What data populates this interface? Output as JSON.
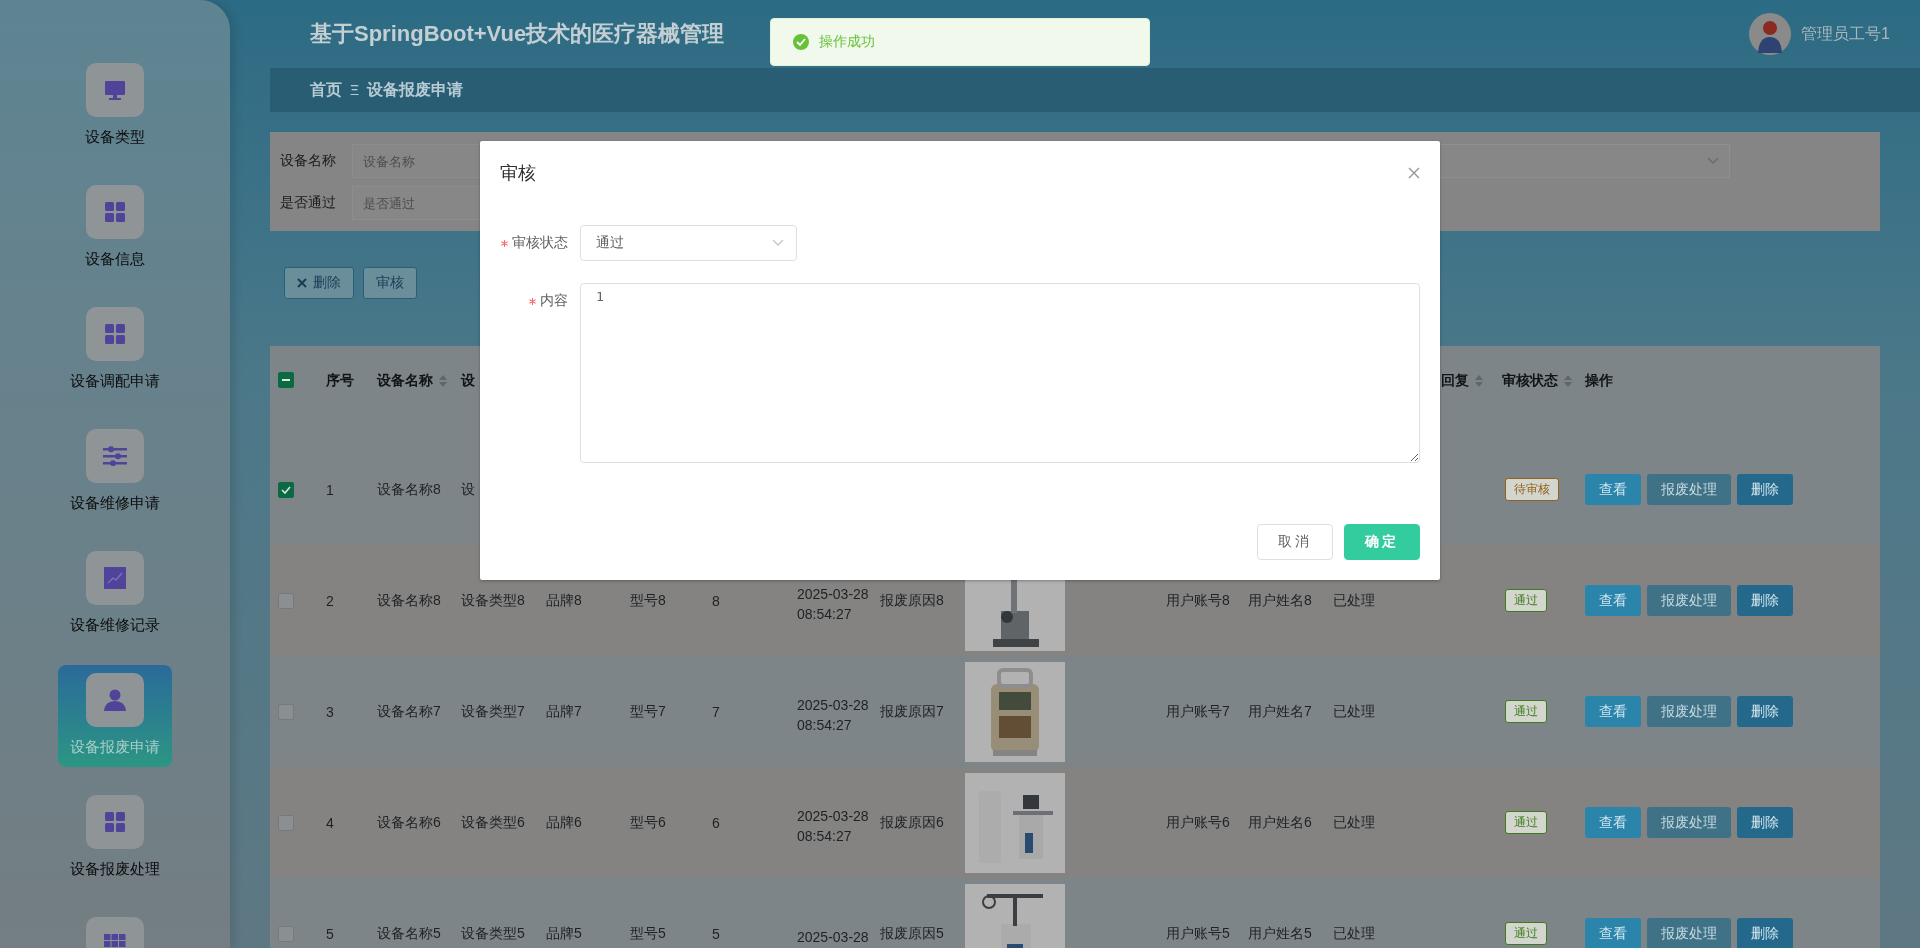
{
  "header": {
    "title": "基于SpringBoot+Vue技术的医疗器械管理",
    "user": "管理员工号1"
  },
  "toast": {
    "message": "操作成功"
  },
  "sidebar": {
    "items": [
      {
        "label": "设备类型",
        "selected": false
      },
      {
        "label": "设备信息",
        "selected": false
      },
      {
        "label": "设备调配申请",
        "selected": false
      },
      {
        "label": "设备维修申请",
        "selected": false
      },
      {
        "label": "设备维修记录",
        "selected": false
      },
      {
        "label": "设备报废申请",
        "selected": true
      },
      {
        "label": "设备报废处理",
        "selected": false
      },
      {
        "selected": false
      }
    ]
  },
  "breadcrumb": {
    "items": [
      "首页",
      "设备报废申请"
    ],
    "separator": "Ξ"
  },
  "search": {
    "fields": [
      {
        "label": "设备名称",
        "placeholder": "设备名称"
      },
      {
        "label": "是否通过",
        "placeholder": "是否通过"
      }
    ]
  },
  "toolbar": [
    {
      "label": "删除",
      "kind": "delete"
    },
    {
      "label": "审核",
      "kind": "review"
    }
  ],
  "table": {
    "select_all": {
      "indeterminate": true
    },
    "columns": [
      {
        "label": "序号",
        "sortable": false
      },
      {
        "label": "设备名称",
        "sortable": true
      },
      {
        "label": "设",
        "sortable": false
      },
      {},
      {},
      {},
      {},
      {},
      {},
      {},
      {},
      {},
      {
        "label": "回复",
        "sortable": true
      },
      {
        "label": "审核状态",
        "sortable": true
      },
      {
        "label": "操作",
        "sortable": false
      }
    ],
    "rows": [
      {
        "selected": true,
        "index": "1",
        "name": "设备名称8",
        "type": "设",
        "status": {
          "label": "待审核",
          "color": "#94601c"
        },
        "actions": [
          {
            "label": "查看",
            "kind": "view",
            "disabled": false
          },
          {
            "label": "报废处理",
            "kind": "process",
            "disabled": true
          },
          {
            "label": "删除",
            "kind": "delete",
            "disabled": false
          }
        ]
      },
      {
        "selected": false,
        "index": "2",
        "name": "设备名称8",
        "type": "设备类型8",
        "brand": "品牌8",
        "model": "型号8",
        "quantity": "8",
        "date": "2025-03-28 08:54:27",
        "reason": "报废原因8",
        "account": "用户账号8",
        "user": "用户姓名8",
        "processed": "已处理",
        "status": {
          "label": "通过",
          "color": "#3f7a1f"
        },
        "actions": [
          {
            "label": "查看",
            "kind": "view",
            "disabled": false
          },
          {
            "label": "报废处理",
            "kind": "process",
            "disabled": true
          },
          {
            "label": "删除",
            "kind": "delete",
            "disabled": false
          }
        ]
      },
      {
        "selected": false,
        "index": "3",
        "name": "设备名称7",
        "type": "设备类型7",
        "brand": "品牌7",
        "model": "型号7",
        "quantity": "7",
        "date": "2025-03-28 08:54:27",
        "reason": "报废原因7",
        "account": "用户账号7",
        "user": "用户姓名7",
        "processed": "已处理",
        "status": {
          "label": "通过",
          "color": "#3f7a1f"
        },
        "actions": [
          {
            "label": "查看",
            "kind": "view",
            "disabled": false
          },
          {
            "label": "报废处理",
            "kind": "process",
            "disabled": true
          },
          {
            "label": "删除",
            "kind": "delete",
            "disabled": false
          }
        ]
      },
      {
        "selected": false,
        "index": "4",
        "name": "设备名称6",
        "type": "设备类型6",
        "brand": "品牌6",
        "model": "型号6",
        "quantity": "6",
        "date": "2025-03-28 08:54:27",
        "reason": "报废原因6",
        "account": "用户账号6",
        "user": "用户姓名6",
        "processed": "已处理",
        "status": {
          "label": "通过",
          "color": "#3f7a1f"
        },
        "actions": [
          {
            "label": "查看",
            "kind": "view",
            "disabled": false
          },
          {
            "label": "报废处理",
            "kind": "process",
            "disabled": true
          },
          {
            "label": "删除",
            "kind": "delete",
            "disabled": false
          }
        ]
      },
      {
        "selected": false,
        "index": "5",
        "name": "设备名称5",
        "type": "设备类型5",
        "brand": "品牌5",
        "model": "型号5",
        "quantity": "5",
        "date": "2025-03-28",
        "reason": "报废原因5",
        "account": "用户账号5",
        "user": "用户姓名5",
        "processed": "已处理",
        "status": {
          "label": "通过",
          "color": "#3f7a1f"
        },
        "actions": [
          {
            "label": "查看",
            "kind": "view",
            "disabled": false
          },
          {
            "label": "报废处理",
            "kind": "process",
            "disabled": true
          },
          {
            "label": "删除",
            "kind": "delete",
            "disabled": false
          }
        ]
      }
    ]
  },
  "dialog": {
    "title": "审核",
    "fields": [
      {
        "label": "审核状态",
        "required": true,
        "kind": "select",
        "value": "通过"
      },
      {
        "label": "内容",
        "required": true,
        "kind": "textarea",
        "value": "1"
      }
    ],
    "buttons": [
      {
        "label": "取消",
        "kind": "default"
      },
      {
        "label": "确定",
        "kind": "primary"
      }
    ]
  }
}
